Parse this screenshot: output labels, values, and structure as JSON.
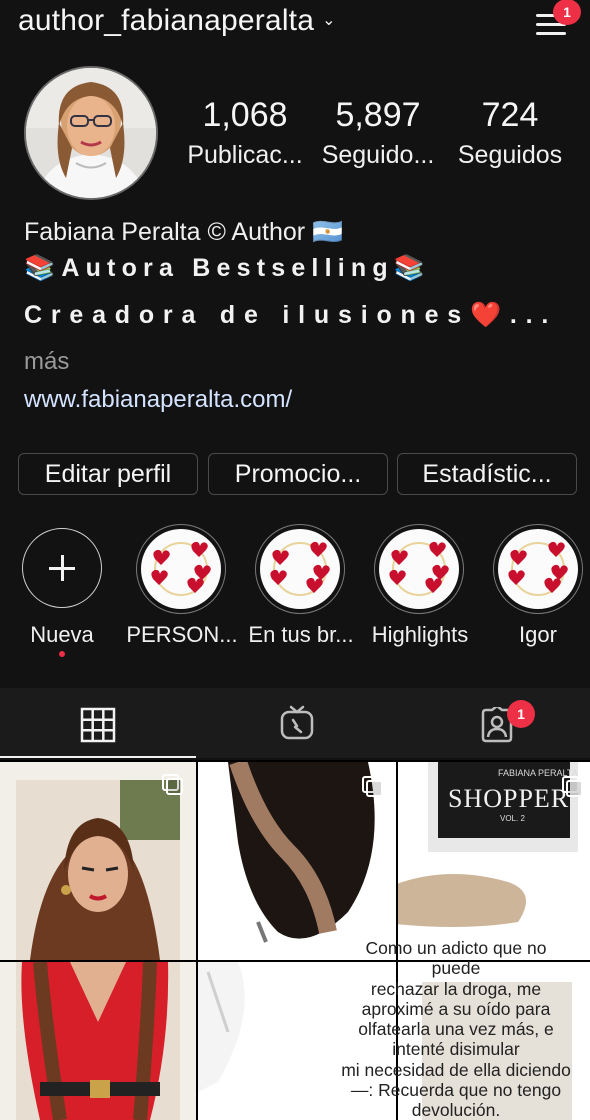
{
  "header": {
    "username": "author_fabianaperalta",
    "chevron": "⌄",
    "menu_badge": "1"
  },
  "stats": [
    {
      "value": "1,068",
      "label": "Publicac..."
    },
    {
      "value": "5,897",
      "label": "Seguido..."
    },
    {
      "value": "724",
      "label": "Seguidos"
    }
  ],
  "bio": {
    "name": "Fabiana Peralta © Author 🇦🇷",
    "line1": "📚Autora Bestselling📚",
    "line2": "Creadora de ilusiones❤️...",
    "more": "más",
    "link": "www.fabianaperalta.com/"
  },
  "buttons": {
    "edit": "Editar perfil",
    "promo": "Promocio...",
    "stats": "Estadístic..."
  },
  "highlights": {
    "new_label": "Nueva",
    "items": [
      "PERSON...",
      "En tus br...",
      "Highlights",
      "Igor"
    ]
  },
  "tabs": {
    "tagged_badge": "1"
  },
  "posts": {
    "shopper_author": "FABIANA PERALTA",
    "shopper_title": "SHOPPER",
    "shopper_vol": "VOL. 2",
    "quote_lines": [
      "Como un adicto que no",
      "puede",
      "rechazar la droga, me",
      "aproximé a su oído para",
      "olfatearla una vez más, e",
      "intenté disimular",
      "mi necesidad de ella diciendo",
      "—: Recuerda que no tengo",
      "devolución."
    ]
  },
  "colors": {
    "background": "#121212",
    "accent_red": "#ed3046",
    "link": "#d4e3ff"
  }
}
